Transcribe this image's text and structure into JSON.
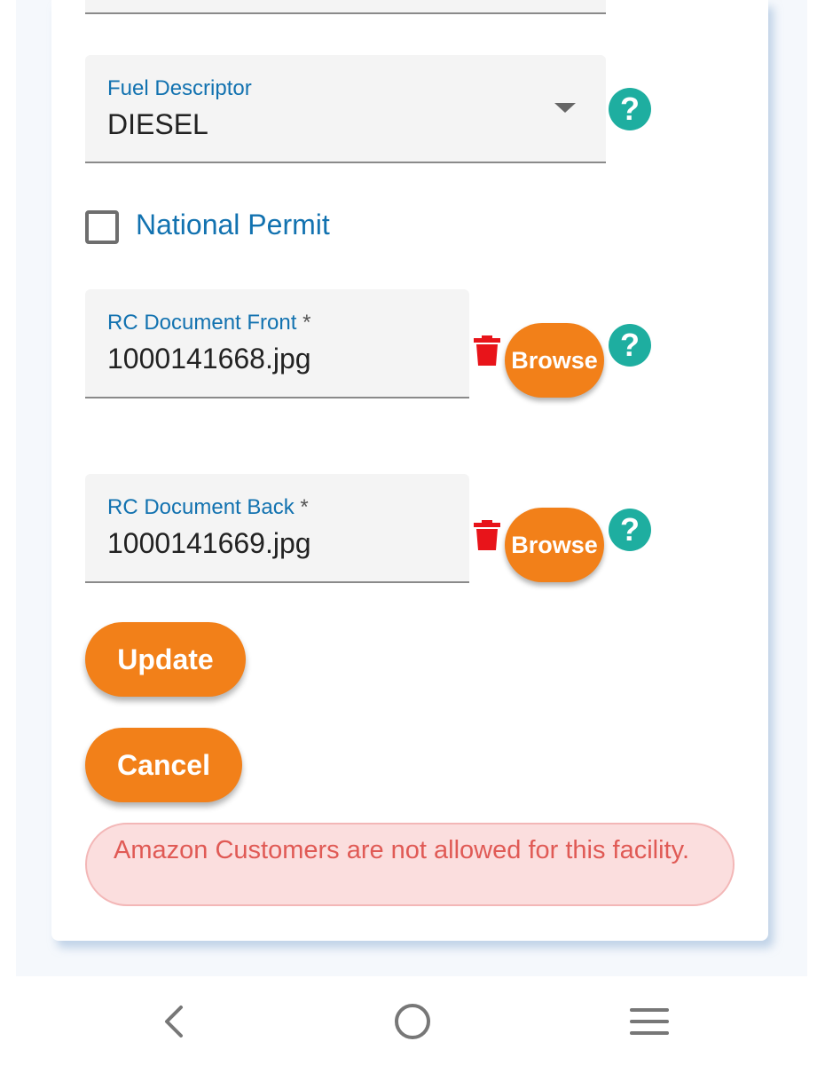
{
  "form": {
    "fuel_descriptor": {
      "label": "Fuel Descriptor",
      "value": "DIESEL"
    },
    "national_permit": {
      "label": "National Permit",
      "checked": false
    },
    "rc_front": {
      "label": "RC Document Front",
      "required_mark": "*",
      "value": "1000141668.jpg",
      "browse_label": "Browse"
    },
    "rc_back": {
      "label": "RC Document Back",
      "required_mark": "*",
      "value": "1000141669.jpg",
      "browse_label": "Browse"
    },
    "help_glyph": "?",
    "update_label": "Update",
    "cancel_label": "Cancel",
    "alert_message": "Amazon Customers are not allowed for this facility."
  },
  "colors": {
    "accent_orange": "#f28019",
    "help_teal": "#1eaea0",
    "label_blue": "#1272b0",
    "delete_red": "#e8141a",
    "alert_bg": "#fbdede",
    "alert_text": "#e05a55"
  },
  "icons": {
    "dropdown": "caret-down-icon",
    "help": "question-mark-icon",
    "delete": "trash-icon",
    "nav_back": "back-chevron-icon",
    "nav_home": "home-circle-icon",
    "nav_recents": "recents-menu-icon"
  }
}
